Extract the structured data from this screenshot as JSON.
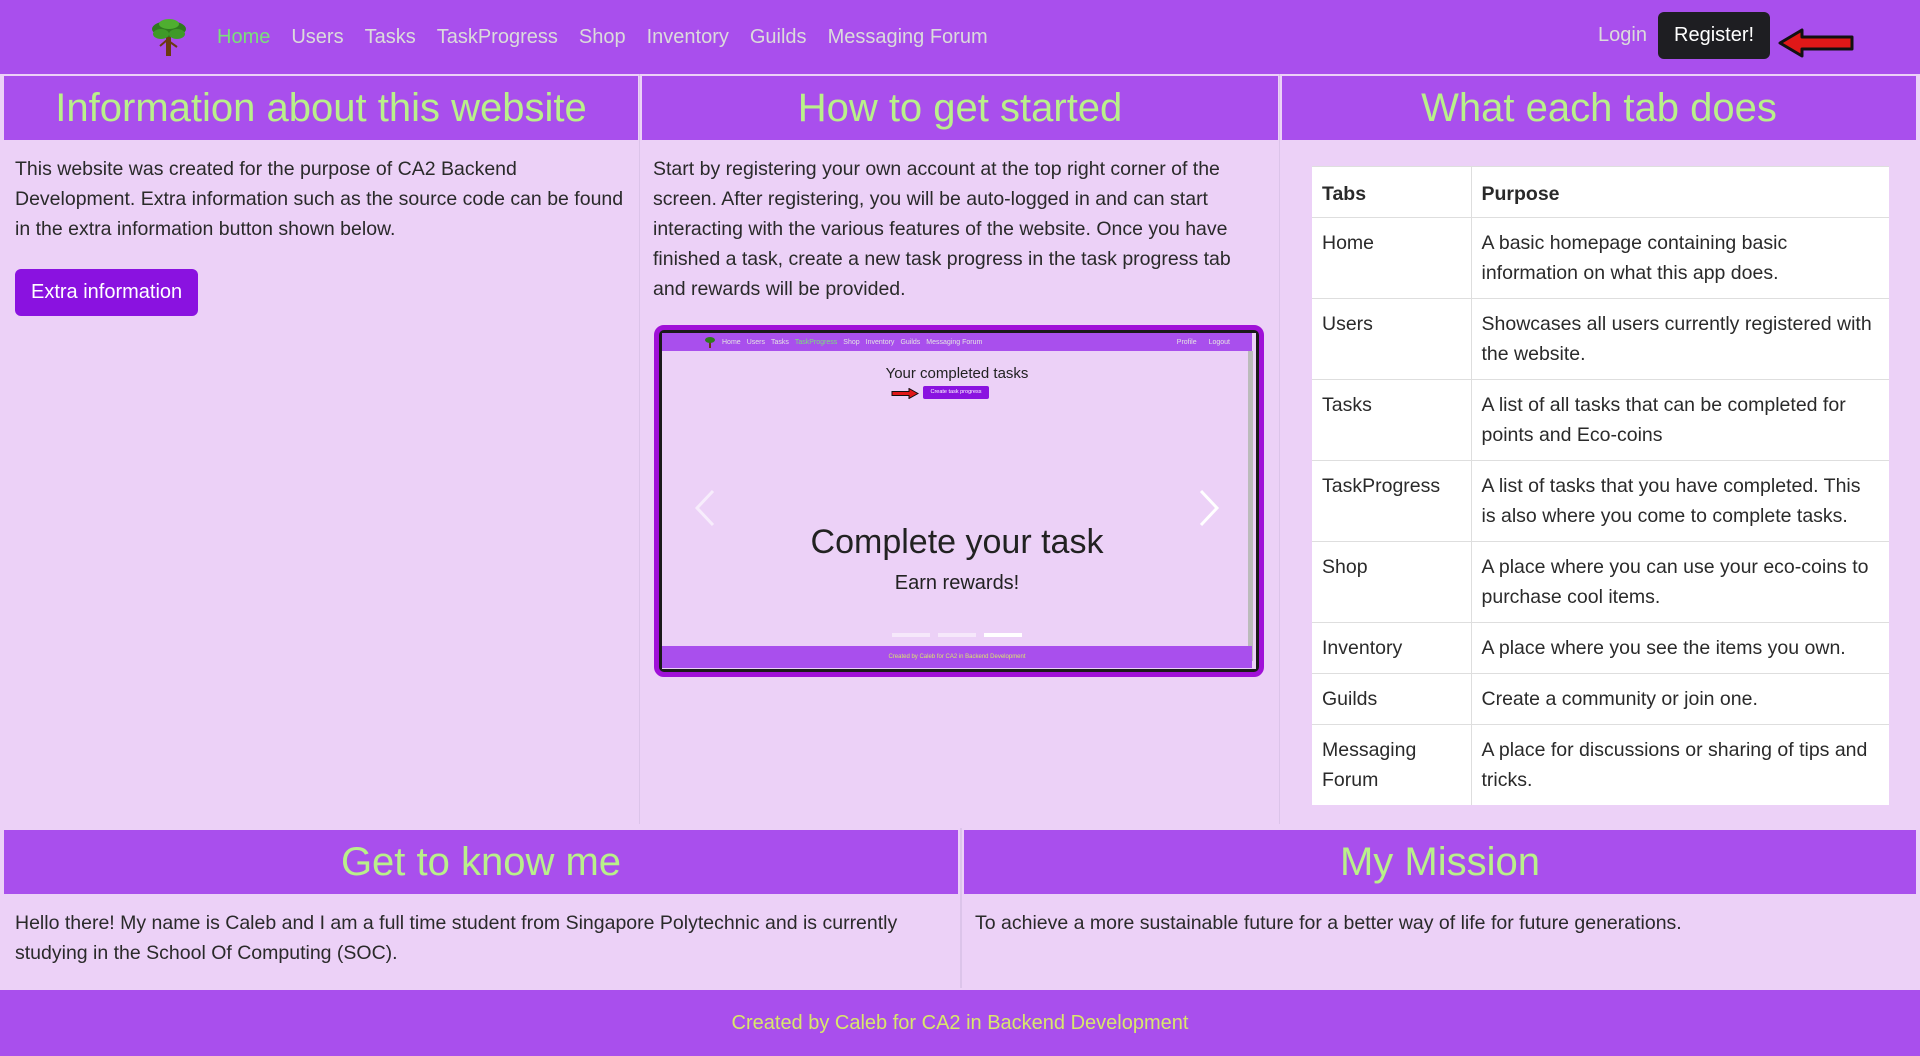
{
  "nav": {
    "brand": "tree-logo",
    "links": [
      "Home",
      "Users",
      "Tasks",
      "TaskProgress",
      "Shop",
      "Inventory",
      "Guilds",
      "Messaging Forum"
    ],
    "active": "Home",
    "login": "Login",
    "register": "Register!"
  },
  "info": {
    "title": "Information about this website",
    "text": "This website was created for the purpose of CA2 Backend Development. Extra information such as the source code can be found in the extra information button shown below.",
    "button": "Extra information"
  },
  "started": {
    "title": "How to get started",
    "text": "Start by registering your own account at the top right corner of the screen. After registering, you will be auto-logged in and can start interacting with the various features of the website. Once you have finished a task, create a new task progress in the task progress tab and rewards will be provided.",
    "carousel": {
      "mini_nav": [
        "Home",
        "Users",
        "Tasks",
        "TaskProgress",
        "Shop",
        "Inventory",
        "Guilds",
        "Messaging Forum"
      ],
      "mini_active": "TaskProgress",
      "mini_right": [
        "Profile",
        "Logout"
      ],
      "mini_title": "Your completed tasks",
      "mini_button": "Create task progress",
      "mini_footer": "Created by Caleb for CA2 in Backend Development",
      "caption_title": "Complete your task",
      "caption_text": "Earn rewards!",
      "slides": 3,
      "active_slide": 3
    }
  },
  "tabs": {
    "title": "What each tab does",
    "headers": [
      "Tabs",
      "Purpose"
    ],
    "rows": [
      [
        "Home",
        "A basic homepage containing basic information on what this app does."
      ],
      [
        "Users",
        "Showcases all users currently registered with the website."
      ],
      [
        "Tasks",
        "A list of all tasks that can be completed for points and Eco-coins"
      ],
      [
        "TaskProgress",
        "A list of tasks that you have completed. This is also where you come to complete tasks."
      ],
      [
        "Shop",
        "A place where you can use your eco-coins to purchase cool items."
      ],
      [
        "Inventory",
        "A place where you see the items you own."
      ],
      [
        "Guilds",
        "Create a community or join one."
      ],
      [
        "Messaging Forum",
        "A place for discussions or sharing of tips and tricks."
      ]
    ]
  },
  "me": {
    "title": "Get to know me",
    "text": "Hello there! My name is Caleb and I am a full time student from Singapore Polytechnic and is currently studying in the School Of Computing (SOC)."
  },
  "mission": {
    "title": "My Mission",
    "text": "To achieve a more sustainable future for a better way of life for future generations."
  },
  "footer": {
    "text": "Created by Caleb for CA2 in Backend Development"
  },
  "colors": {
    "nav_bg": "#a94fed",
    "page_bg": "#ecd1f7",
    "heading": "#b9f08a",
    "footer_text": "#d8e86a",
    "accent_button": "#8a12e0"
  }
}
